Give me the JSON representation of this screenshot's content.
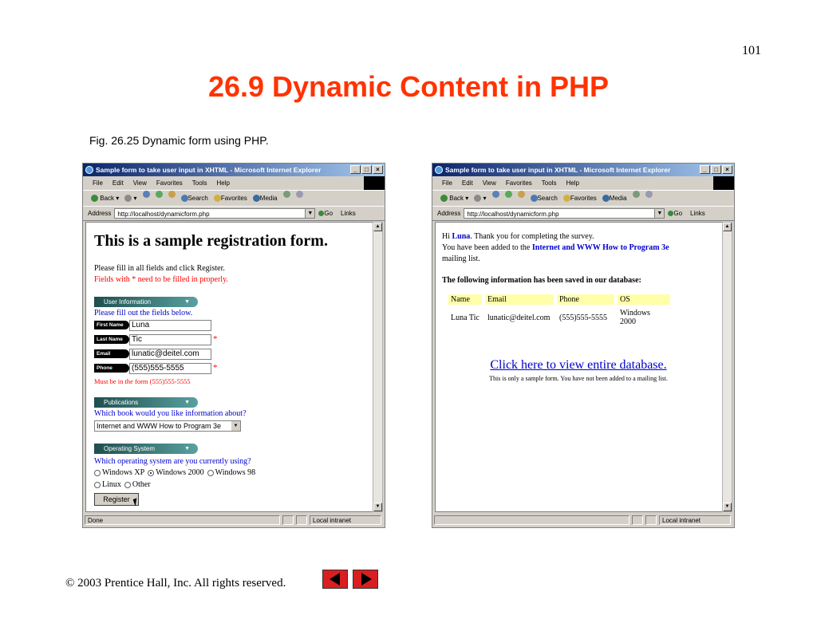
{
  "slide": {
    "page_number": "101",
    "title": "26.9 Dynamic Content in PHP",
    "caption": "Fig. 26.25   Dynamic form using PHP.",
    "footer": "© 2003 Prentice Hall, Inc.  All rights reserved."
  },
  "browser": {
    "window_title": "Sample form to take user input in XHTML - Microsoft Internet Explorer",
    "menu": [
      "File",
      "Edit",
      "View",
      "Favorites",
      "Tools",
      "Help"
    ],
    "toolbar": {
      "back": "Back",
      "search": "Search",
      "favorites": "Favorites",
      "media": "Media"
    },
    "address_label": "Address",
    "address_url": "http://localhost/dynamicform.php",
    "go_label": "Go",
    "links_label": "Links",
    "status_done": "Done",
    "status_zone": "Local intranet"
  },
  "form_page": {
    "heading": "This is a sample registration form.",
    "instructions": "Please fill in all fields and click Register.",
    "required_note": "Fields with * need to be filled in properly.",
    "user_info_section": "User Information",
    "user_info_prompt": "Please fill out the fields below.",
    "fields": [
      {
        "label": "First Name",
        "value": "Luna"
      },
      {
        "label": "Last Name",
        "value": "Tic"
      },
      {
        "label": "Email",
        "value": "lunatic@deitel.com"
      },
      {
        "label": "Phone",
        "value": "(555)555-5555"
      }
    ],
    "phone_format": "Must be in the form (555)555-5555",
    "publications_section": "Publications",
    "book_prompt": "Which book would you like information about?",
    "book_selected": "Internet and WWW How to Program 3e",
    "os_section": "Operating System",
    "os_prompt": "Which operating system are you currently using?",
    "os_options": [
      "Windows XP",
      "Windows 2000",
      "Windows 98",
      "Linux",
      "Other"
    ],
    "os_selected": "Windows 2000",
    "register_label": "Register"
  },
  "result_page": {
    "hi": "Hi",
    "name": "Luna",
    "thanks": ". Thank you for completing the survey.",
    "added_prefix": "You have been added to the",
    "book": "Internet and WWW How to Program 3e",
    "mailing_list": "mailing list.",
    "saved_heading": "The following information has been saved in our database:",
    "table_headers": [
      "Name",
      "Email",
      "Phone",
      "OS"
    ],
    "table_row": [
      "Luna Tic",
      "lunatic@deitel.com",
      "(555)555-5555",
      "Windows 2000"
    ],
    "db_link": "Click here to view entire database.",
    "note": "This is only a sample form. You have not been added to a mailing list."
  }
}
